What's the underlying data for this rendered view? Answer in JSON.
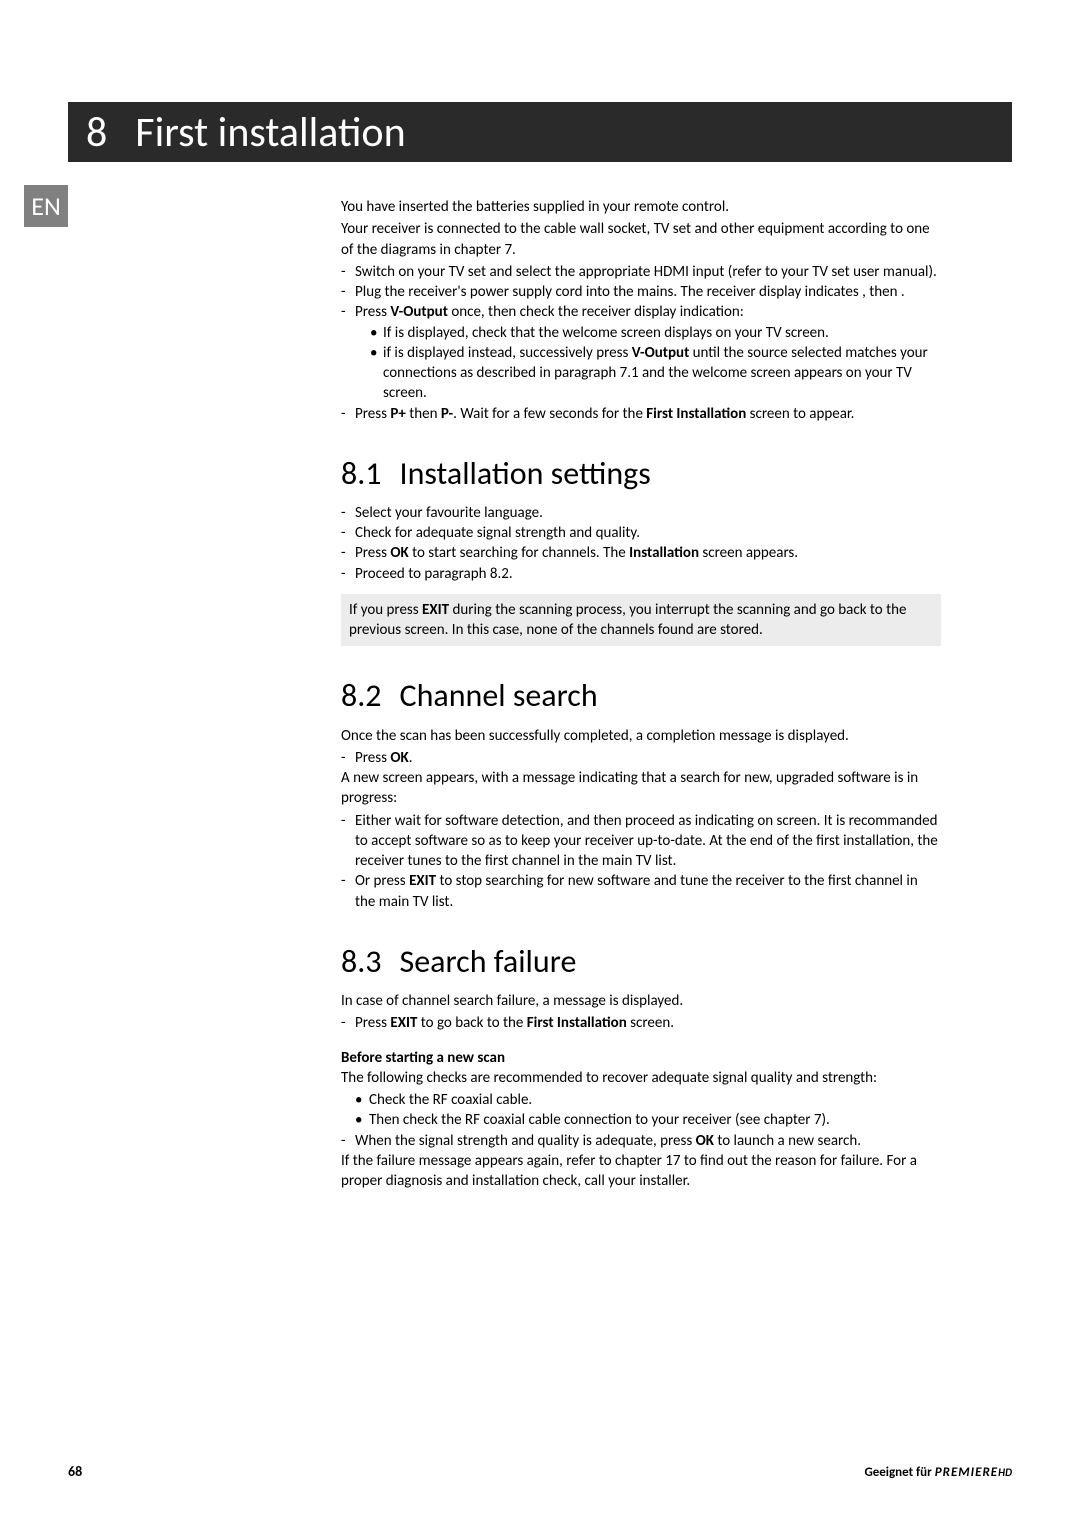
{
  "chapter": {
    "number": "8",
    "title": "First installation"
  },
  "langTab": "EN",
  "intro": {
    "p1": "You have inserted the batteries supplied in your remote control.",
    "p2": "Your receiver is connected to the cable wall socket, TV set and other equipment according to one of the diagrams in chapter 7.",
    "l1": "Switch on your TV set and select the appropriate HDMI input (refer to your TV set user manual).",
    "l2a": "Plug the receiver's power supply cord into the mains. The receiver display indicates ",
    "l2b": ", then ",
    "l2c": ".",
    "l3a": "Press ",
    "l3b": "V-Output",
    "l3c": " once, then check the receiver display indication:",
    "l3i1a": "If ",
    "l3i1b": " is displayed, check that the welcome screen displays on your TV screen.",
    "l3i2a": "if ",
    "l3i2b": " is displayed instead, successively press ",
    "l3i2c": "V-Output",
    "l3i2d": " until the source selected matches your connections as described in paragraph 7.1 and the welcome screen appears on your TV screen.",
    "l4a": "Press ",
    "l4b": "P+",
    "l4c": " then ",
    "l4d": "P-",
    "l4e": ". Wait for a few seconds for the ",
    "l4f": "First Installation",
    "l4g": " screen to appear."
  },
  "s81": {
    "num": "8.1",
    "title": "Installation settings",
    "l1": "Select your favourite language.",
    "l2": "Check for adequate signal strength and quality.",
    "l3a": "Press ",
    "l3b": "OK",
    "l3c": " to start searching for channels. The ",
    "l3d": "Installation",
    "l3e": " screen appears.",
    "l4": "Proceed to paragraph 8.2.",
    "callout_a": "If you press ",
    "callout_b": "EXIT",
    "callout_c": " during the scanning process, you interrupt the scanning and go back to the previous screen. In this case, none of the channels found are stored."
  },
  "s82": {
    "num": "8.2",
    "title": "Channel search",
    "p1": "Once the scan has been successfully completed, a completion message is displayed.",
    "l1a": "Press ",
    "l1b": "OK",
    "l1c": ".",
    "p2": "A new screen appears, with a message indicating that a search for new, upgraded software is in progress:",
    "l2": "Either wait for software detection, and then proceed as indicating on screen. It is recommanded to accept software so as to keep your receiver up-to-date. At the end of the first installation, the receiver tunes to the first channel in the main TV list.",
    "l3a": "Or press ",
    "l3b": "EXIT",
    "l3c": " to stop searching for new software and tune the receiver to the first channel in the main TV list."
  },
  "s83": {
    "num": "8.3",
    "title": "Search failure",
    "p1": "In case of channel search failure, a message is displayed.",
    "l1a": "Press ",
    "l1b": "EXIT",
    "l1c": " to go back to the ",
    "l1d": "First Installation",
    "l1e": " screen.",
    "subhead": "Before starting a new scan",
    "p2": "The following checks are recommended to recover adequate signal quality and strength:",
    "b1": "Check the RF coaxial cable.",
    "b2": "Then check the RF coaxial cable connection to your receiver (see chapter 7).",
    "l2a": "When the signal strength and quality is adequate, press ",
    "l2b": "OK",
    "l2c": " to launch a new search.",
    "p3": "If the failure message appears again, refer to chapter 17 to find out the reason for failure. For a proper diagnosis and installation check, call your installer."
  },
  "footer": {
    "page": "68",
    "prefix": "Geeignet für ",
    "brand": "PREMIERE",
    "suffix": "HD"
  }
}
